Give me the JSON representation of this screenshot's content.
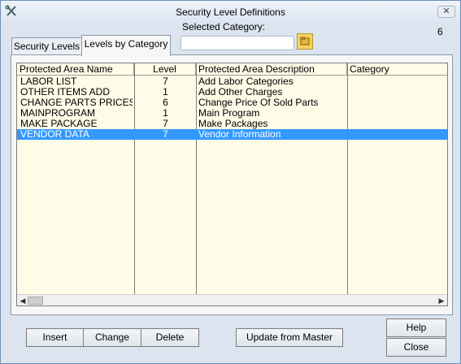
{
  "window": {
    "title": "Security Level Definitions",
    "count": "6"
  },
  "selected_category": {
    "label": "Selected Category:",
    "value": ""
  },
  "tabs": [
    {
      "label": "Security Levels",
      "active": false
    },
    {
      "label": "Levels by Category",
      "active": true
    }
  ],
  "table": {
    "columns": [
      "Protected Area Name",
      "Level",
      "Protected Area Description",
      "Category"
    ],
    "rows": [
      {
        "name": "LABOR LIST",
        "level": "7",
        "description": "Add Labor Categories",
        "category": ""
      },
      {
        "name": "OTHER ITEMS ADD",
        "level": "1",
        "description": "Add Other Charges",
        "category": ""
      },
      {
        "name": "CHANGE PARTS PRICES",
        "level": "6",
        "description": "Change Price Of Sold Parts",
        "category": ""
      },
      {
        "name": "MAINPROGRAM",
        "level": "1",
        "description": "Main Program",
        "category": ""
      },
      {
        "name": "MAKE PACKAGE",
        "level": "7",
        "description": "Make Packages",
        "category": ""
      },
      {
        "name": "VENDOR DATA",
        "level": "7",
        "description": "Vendor Information",
        "category": "",
        "selected": true
      }
    ]
  },
  "buttons": {
    "insert": "Insert",
    "change": "Change",
    "delete": "Delete",
    "update_master": "Update from Master",
    "help": "Help",
    "close": "Close"
  },
  "icons": {
    "app": "tools-icon",
    "folder": "folder-icon",
    "close": "close-icon",
    "scroll_left": "arrow-left-icon",
    "scroll_right": "arrow-right-icon"
  },
  "colors": {
    "selection": "#3399ff",
    "grid_background": "#fefbe6",
    "window": "#dbe4ef"
  }
}
